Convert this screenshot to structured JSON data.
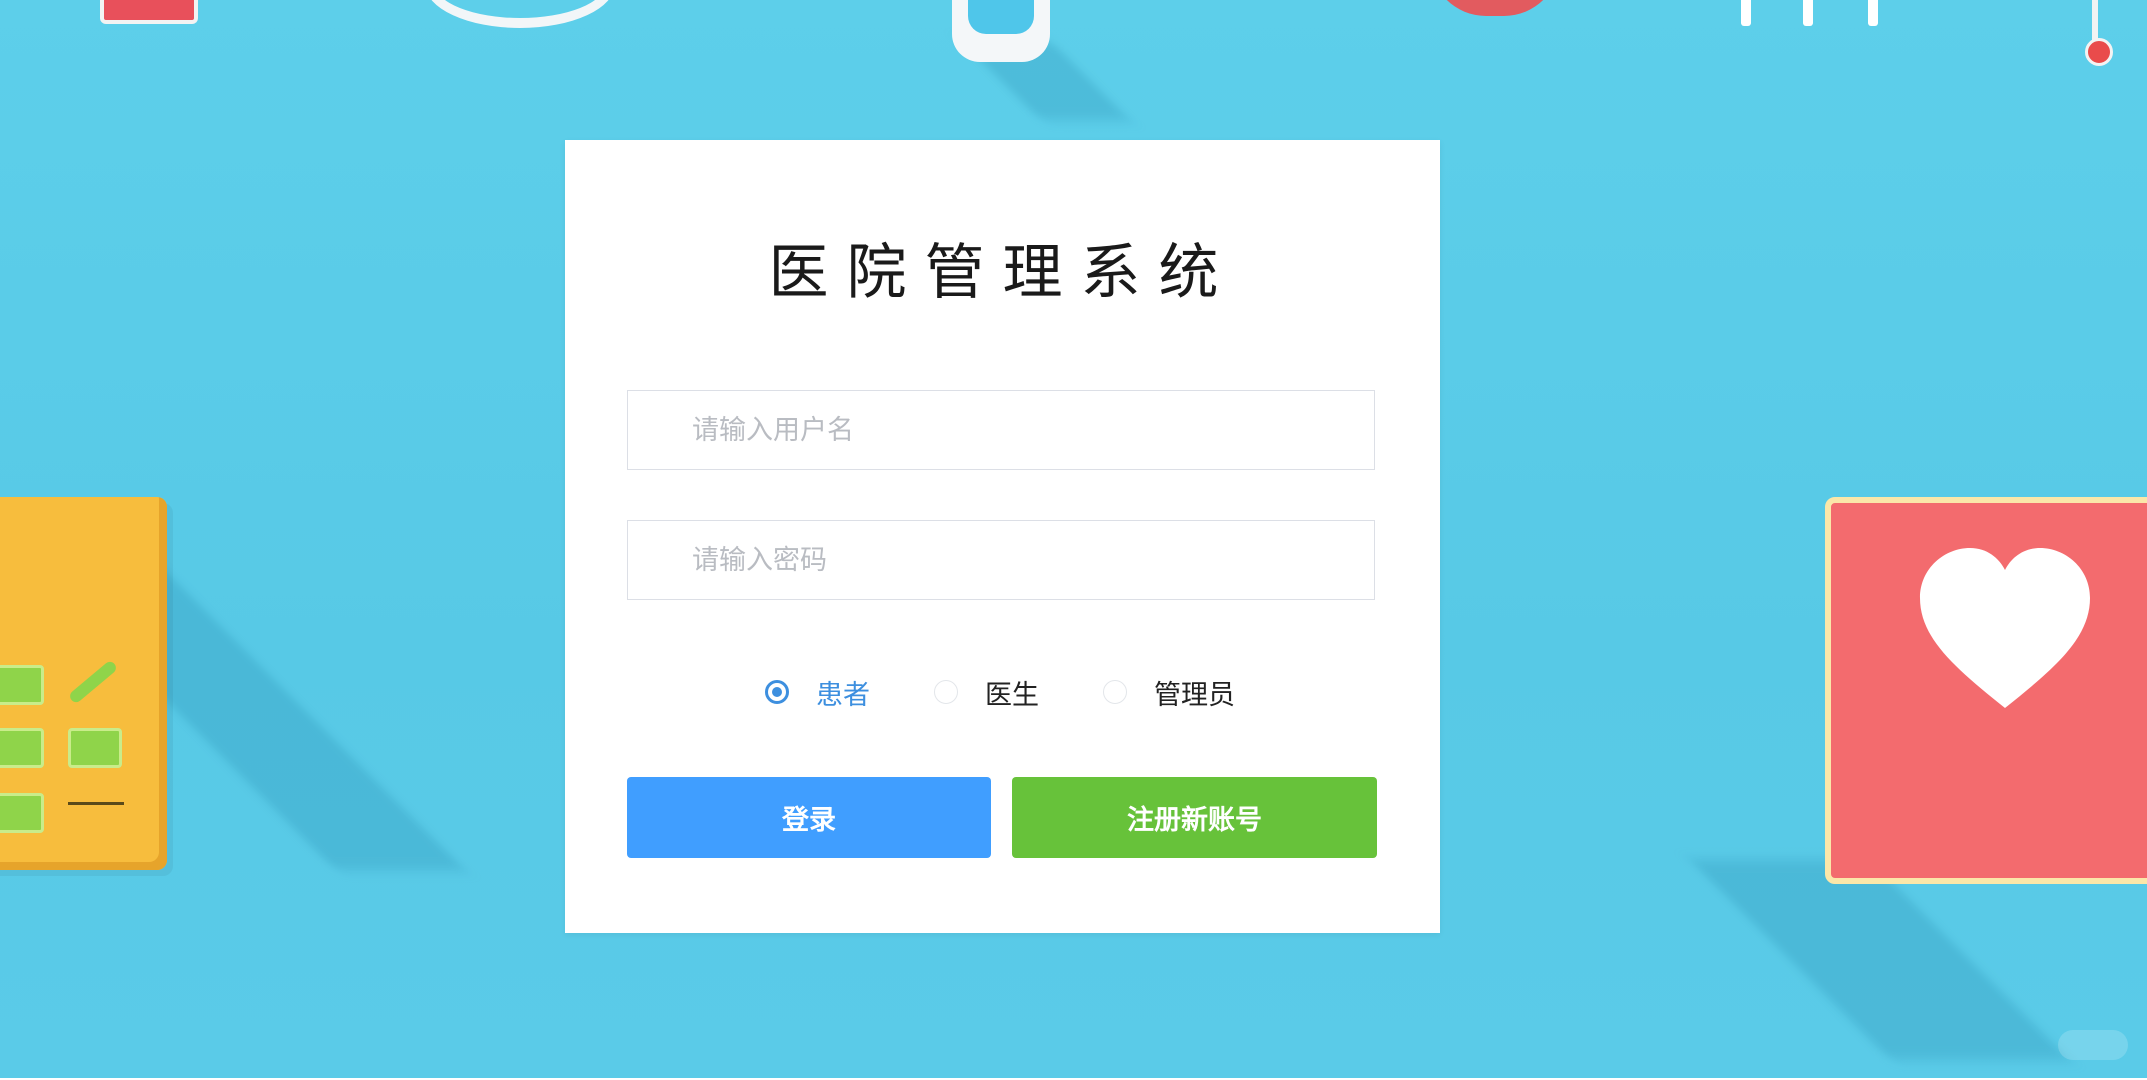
{
  "app": {
    "title": "医院管理系统"
  },
  "form": {
    "username_placeholder": "请输入用户名",
    "username_value": "",
    "password_placeholder": "请输入密码",
    "password_value": "",
    "roles": [
      {
        "label": "患者",
        "selected": true
      },
      {
        "label": "医生",
        "selected": false
      },
      {
        "label": "管理员",
        "selected": false
      }
    ],
    "login_label": "登录",
    "register_label": "注册新账号"
  },
  "colors": {
    "background": "#5ccfe9",
    "panel": "#ffffff",
    "login_button": "#409eff",
    "register_button": "#67c23a",
    "radio_selected": "#3d8fdf"
  },
  "decorations": {
    "left": "clipboard-checklist-icon",
    "right": "heart-card-icon",
    "top": [
      "red-tab",
      "stethoscope-ring",
      "test-tube",
      "red-dome",
      "chart-bars",
      "thermometer"
    ]
  }
}
